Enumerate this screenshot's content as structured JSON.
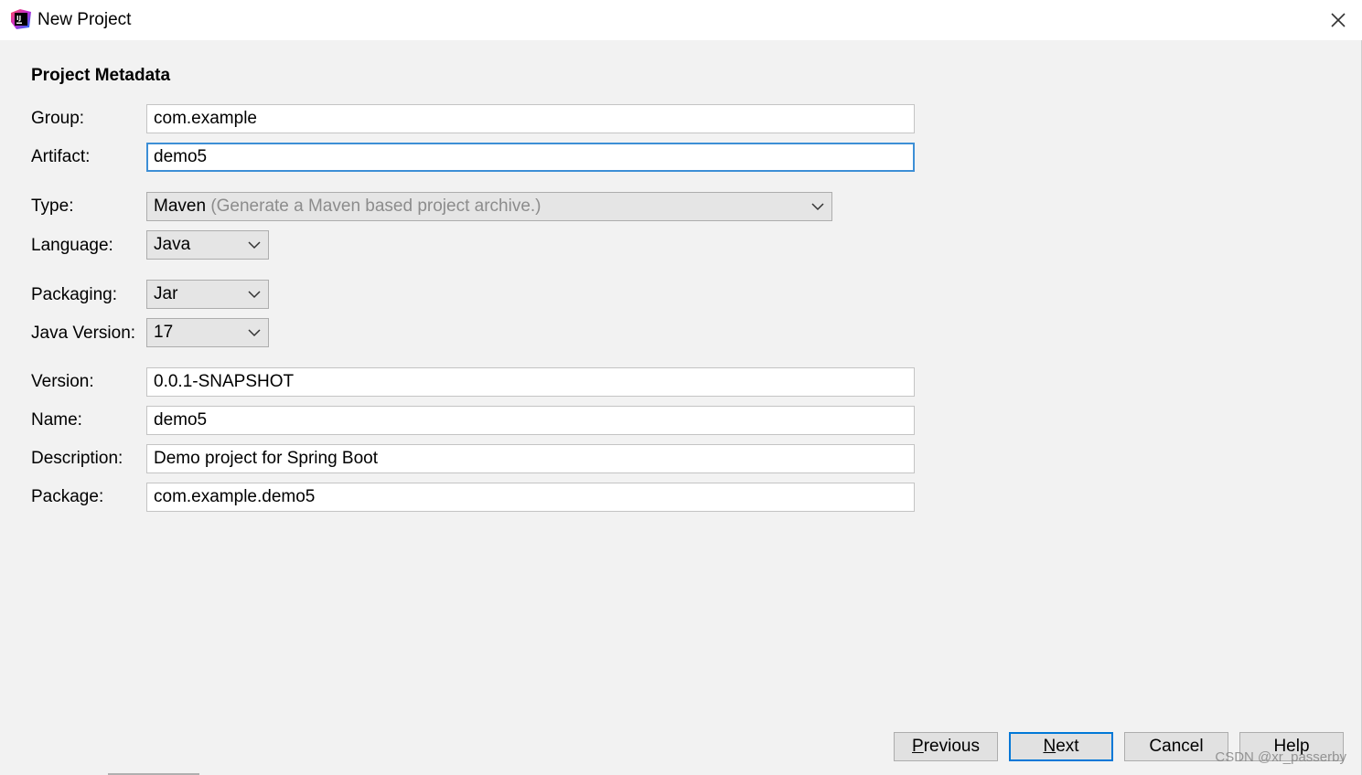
{
  "window": {
    "title": "New Project",
    "app_icon": "intellij-idea-icon",
    "close_icon": "close-icon"
  },
  "section_title": "Project Metadata",
  "fields": {
    "group": {
      "label": "Group:",
      "value": "com.example"
    },
    "artifact": {
      "label": "Artifact:",
      "value": "demo5"
    },
    "type": {
      "label": "Type:",
      "value": "Maven",
      "hint": "(Generate a Maven based project archive.)"
    },
    "language": {
      "label": "Language:",
      "value": "Java"
    },
    "packaging": {
      "label": "Packaging:",
      "value": "Jar"
    },
    "java_version": {
      "label": "Java Version:",
      "value": "17"
    },
    "version": {
      "label": "Version:",
      "value": "0.0.1-SNAPSHOT"
    },
    "name": {
      "label": "Name:",
      "value": "demo5"
    },
    "description": {
      "label": "Description:",
      "value": "Demo project for Spring Boot"
    },
    "package": {
      "label": "Package:",
      "value": "com.example.demo5"
    }
  },
  "buttons": {
    "previous": {
      "mnemonic": "P",
      "rest": "revious"
    },
    "next": {
      "mnemonic": "N",
      "rest": "ext"
    },
    "cancel": {
      "label": "Cancel"
    },
    "help": {
      "label": "Help"
    }
  },
  "watermark": "CSDN @xr_passerby",
  "colors": {
    "background": "#f2f2f2",
    "focus_border": "#3d8fd6",
    "default_button_border": "#0078d7"
  }
}
